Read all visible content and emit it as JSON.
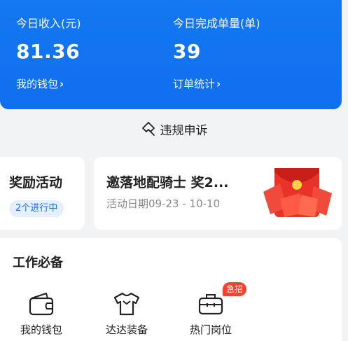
{
  "stats": {
    "income_label": "今日收入(元)",
    "income_value": "81.36",
    "wallet_link": "我的钱包",
    "orders_label": "今日完成单量(单)",
    "orders_value": "39",
    "order_stats_link": "订单统计"
  },
  "violation": {
    "label": "违规申诉"
  },
  "reward": {
    "title": "奖励活动",
    "badge": "2个进行中"
  },
  "promo": {
    "title": "邀落地配骑士 奖2...",
    "date": "活动日期09-23 - 10-10"
  },
  "tools": {
    "title": "工作必备",
    "items": [
      {
        "label": "我的钱包",
        "icon": "wallet-icon"
      },
      {
        "label": "达达装备",
        "icon": "tshirt-icon"
      },
      {
        "label": "热门岗位",
        "icon": "briefcase-icon",
        "badge": "急招"
      }
    ]
  },
  "colors": {
    "primary_blue": "#1478f0",
    "badge_red": "#f0442f",
    "background": "#f2f3f5"
  }
}
